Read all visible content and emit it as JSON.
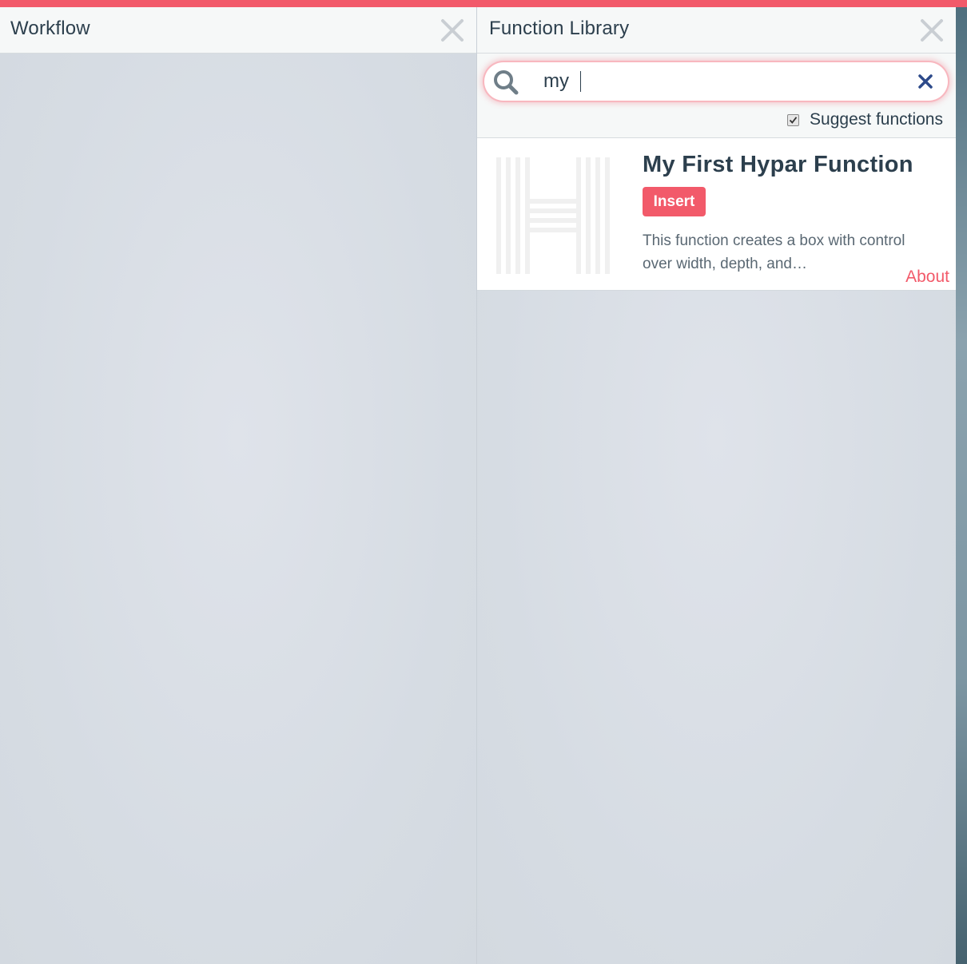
{
  "workflow": {
    "title": "Workflow"
  },
  "library": {
    "title": "Function Library",
    "search": {
      "value": "my",
      "placeholder": ""
    },
    "suggest": {
      "label": "Suggest functions",
      "checked": true
    },
    "results": [
      {
        "title": "My First Hypar Function",
        "insert_label": "Insert",
        "description": "This function creates a box with control over width, depth, and…",
        "about_label": "About",
        "thumbnail_icon": "hypar-logo-icon"
      }
    ]
  },
  "colors": {
    "accent": "#f25a6a",
    "text": "#2c3f4d",
    "muted": "#5a6873"
  },
  "icons": {
    "close": "close-icon",
    "search": "search-icon",
    "clear": "clear-icon",
    "check": "check-icon"
  }
}
